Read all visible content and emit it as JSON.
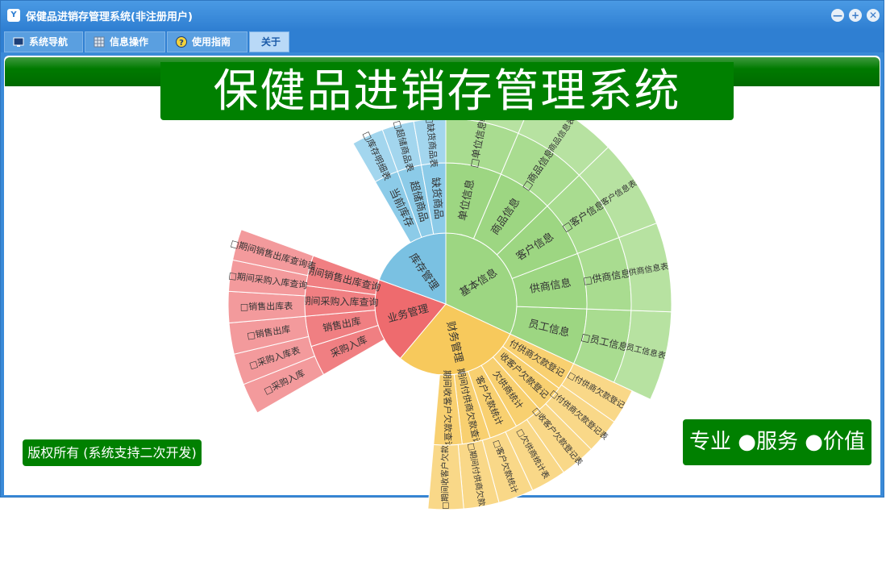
{
  "window": {
    "title": "保健品进销存管理系统(非注册用户)",
    "icon_label": "Y"
  },
  "window_buttons": [
    {
      "name": "minimize-button",
      "glyph": "—"
    },
    {
      "name": "restore-button",
      "glyph": "+"
    },
    {
      "name": "close-button",
      "glyph": "✕"
    }
  ],
  "tabs": [
    {
      "label": "系统导航",
      "icon": "monitor-icon"
    },
    {
      "label": "信息操作",
      "icon": "grid-icon"
    },
    {
      "label": "使用指南",
      "icon": "help-icon"
    },
    {
      "label": "关于",
      "icon": ""
    }
  ],
  "banner": {
    "title": "保健品进销存管理系统"
  },
  "copyright": "版权所有 (系统支持二次开发)",
  "slogan": "专业 ●服务 ●价值",
  "colors": {
    "titlebar": "#2f7fd2",
    "green": "#008000",
    "basic": "#9dd682",
    "finance": "#f7c95c",
    "business": "#ee6b6e",
    "inventory": "#7ac1e2"
  },
  "sunburst": {
    "center": [
      {
        "label": "基本信息",
        "color": "#9dd682"
      },
      {
        "label": "财务管理",
        "color": "#f7c95c"
      },
      {
        "label": "业务管理",
        "color": "#ee6b6e"
      },
      {
        "label": "库存管理",
        "color": "#7ac1e2"
      }
    ],
    "basic_ring2": [
      "员工信息",
      "供商信息",
      "客户信息",
      "商品信息",
      "单位信息"
    ],
    "basic_ring3": [
      "□员工信息",
      "□供商信息",
      "□客户信息",
      "□商品信息",
      "□单位信息"
    ],
    "basic_ring4": [
      "员工信息表",
      "供商信息表",
      "客户信息表",
      "商品信息表",
      "单位信息表"
    ],
    "finance_ring2": [
      "付供商欠款登记",
      "收客户欠款登记",
      "欠供商统计",
      "客户欠款统计",
      "期间付供商欠款查询",
      "期间收客户欠款查询"
    ],
    "finance_ring3": [
      "□付供商欠款登记",
      "□付供商欠款登记表",
      "□收客户欠款登记表",
      "□欠供商统计表",
      "□客户欠款统计",
      "□期间付供商欠款",
      "□期间收客户欠款"
    ],
    "business_ring2": [
      "采购入库",
      "销售出库",
      "期间采购入库查询",
      "期间销售出库查询"
    ],
    "business_ring3": [
      "□采购入库",
      "□采购入库表",
      "□销售出库",
      "□销售出库表",
      "□期间采购入库查询",
      "□期间销售出库查询表"
    ],
    "inventory_ring2": [
      "当前库存",
      "超储商品",
      "缺货商品"
    ],
    "inventory_ring3": [
      "□库存明细表",
      "□超储商品表",
      "□缺货商品表"
    ]
  }
}
